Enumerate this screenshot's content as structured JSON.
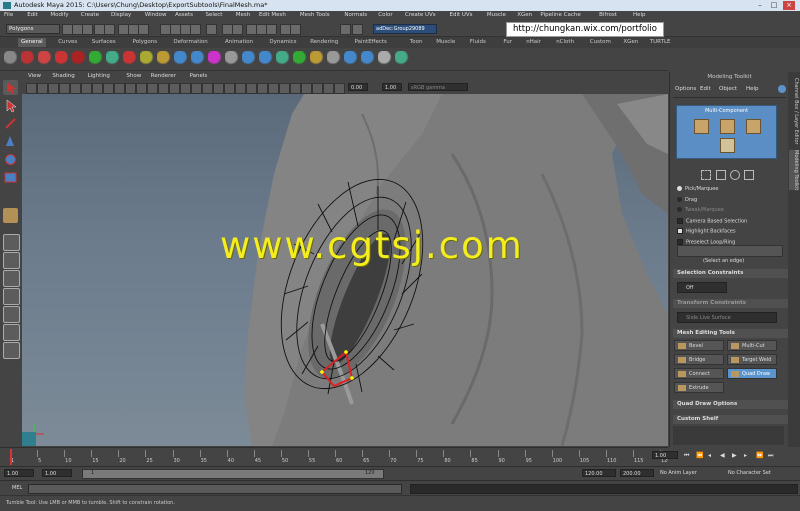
{
  "window": {
    "title": "Autodesk Maya 2015: C:\\Users\\Chung\\Desktop\\ExportSubtools\\FinalMesh.ma*"
  },
  "menubar": [
    "File",
    "Edit",
    "Modify",
    "Create",
    "Display",
    "Window",
    "Assets",
    "Select",
    "Mesh",
    "Edit Mesh",
    "Mesh Tools",
    "Normals",
    "Color",
    "Create UVs",
    "Edit UVs",
    "Muscle",
    "XGen",
    "Pipeline Cache",
    "Bifrost",
    "Help"
  ],
  "status_line": {
    "mode": "Polygons",
    "object_field": "adDec:Group29089",
    "portfolio_url": "http://chungkan.wix.com/portfolio"
  },
  "shelf_tabs": [
    "General",
    "Curves",
    "Surfaces",
    "Polygons",
    "Deformation",
    "Animation",
    "Dynamics",
    "Rendering",
    "PaintEffects",
    "Toon",
    "Muscle",
    "Fluids",
    "Fur",
    "nHair",
    "nCloth",
    "Custom",
    "XGen",
    "TURTLE"
  ],
  "shelf_active_tab": "General",
  "viewport": {
    "menus": [
      "View",
      "Shading",
      "Lighting",
      "Show",
      "Renderer",
      "Panels"
    ],
    "field_value": "0.00",
    "field_value2": "1.00",
    "color_space": "sRGB gamma",
    "watermark": "www.cgtsj.com"
  },
  "modeling_toolkit": {
    "title": "Modeling Toolkit",
    "menus": [
      "Options",
      "Edit",
      "Object",
      "Help"
    ],
    "multi_component_label": "Multi-Component",
    "options": [
      {
        "label": "Pick/Marquee",
        "state": "radio-on",
        "dim": false
      },
      {
        "label": "Drag",
        "state": "radio-off",
        "dim": false
      },
      {
        "label": "Tweak/Marquee",
        "state": "radio-off",
        "dim": true
      },
      {
        "label": "Camera Based Selection",
        "state": "check-off",
        "dim": false
      },
      {
        "label": "Highlight Backfaces",
        "state": "check-on",
        "dim": false
      },
      {
        "label": "Preselect Loop/Ring",
        "state": "check-off",
        "dim": false
      }
    ],
    "select_hint": "(Select an edge)",
    "selection_constraints_title": "Selection Constraints",
    "selection_constraints_value": "Off",
    "transform_constraints_title": "Transform Constraints",
    "transform_constraints_value": "Slide Live Surface",
    "mesh_editing_title": "Mesh Editing Tools",
    "mesh_tools": [
      {
        "label": "Bevel",
        "active": false
      },
      {
        "label": "Multi-Cut",
        "active": false
      },
      {
        "label": "Bridge",
        "active": false
      },
      {
        "label": "Target Weld",
        "active": false
      },
      {
        "label": "Connect",
        "active": false
      },
      {
        "label": "Quad Draw",
        "active": true
      },
      {
        "label": "Extrude",
        "active": false
      }
    ],
    "quad_draw_options_title": "Quad Draw Options",
    "custom_shelf_title": "Custom Shelf"
  },
  "side_tabs": [
    "Channel Box / Layer Editor",
    "Modeling Toolkit"
  ],
  "timeline": {
    "ticks": [
      "1",
      "5",
      "10",
      "15",
      "20",
      "25",
      "30",
      "35",
      "40",
      "45",
      "50",
      "55",
      "60",
      "65",
      "70",
      "75",
      "80",
      "85",
      "90",
      "95",
      "100",
      "105",
      "110",
      "115",
      "120"
    ],
    "current_frame": "1.00"
  },
  "range": {
    "start_field": "1.00",
    "start_field2": "1.00",
    "slider_start": "1",
    "slider_end": "120",
    "end_field": "120.00",
    "end_field2": "200.00",
    "anim_layer": "No Anim Layer",
    "character_set": "No Character Set"
  },
  "command_line": {
    "label": "MEL"
  },
  "help_line": "Tumble Tool: Use LMB or MMB to tumble. Shift to constrain rotation.",
  "colors": {
    "accent_blue": "#5b93cc",
    "watermark_yellow": "#f5ee1e",
    "url_box": "#ffffff"
  }
}
